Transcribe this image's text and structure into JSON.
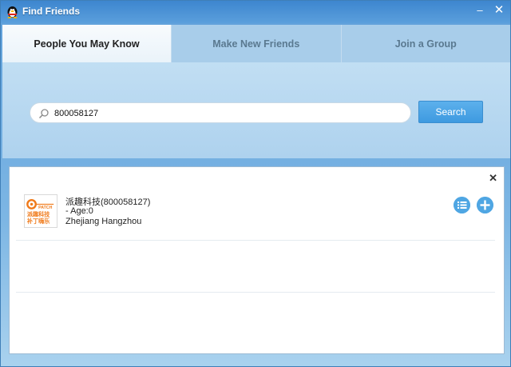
{
  "window": {
    "title": "Find Friends",
    "min_glyph": "–",
    "close_glyph": "✕"
  },
  "tabs": [
    {
      "label": "People You May Know",
      "active": true
    },
    {
      "label": "Make New Friends",
      "active": false
    },
    {
      "label": "Join a Group",
      "active": false
    }
  ],
  "search": {
    "value": "800058127",
    "placeholder": "",
    "button_label": "Search"
  },
  "results": {
    "close_glyph": "✕",
    "items": [
      {
        "name": "派趣科技(800058127)",
        "age": "- Age:0",
        "location": "Zhejiang Hangzhou",
        "avatar_logo": {
          "brand_text": "PATCH",
          "cn_line1": "派趣科技",
          "cn_line2": "补丁嗨乐"
        }
      }
    ]
  },
  "colors": {
    "accent": "#4fa6e3",
    "title_bar": "#3d86cf",
    "avatar_orange": "#f07a1a"
  }
}
